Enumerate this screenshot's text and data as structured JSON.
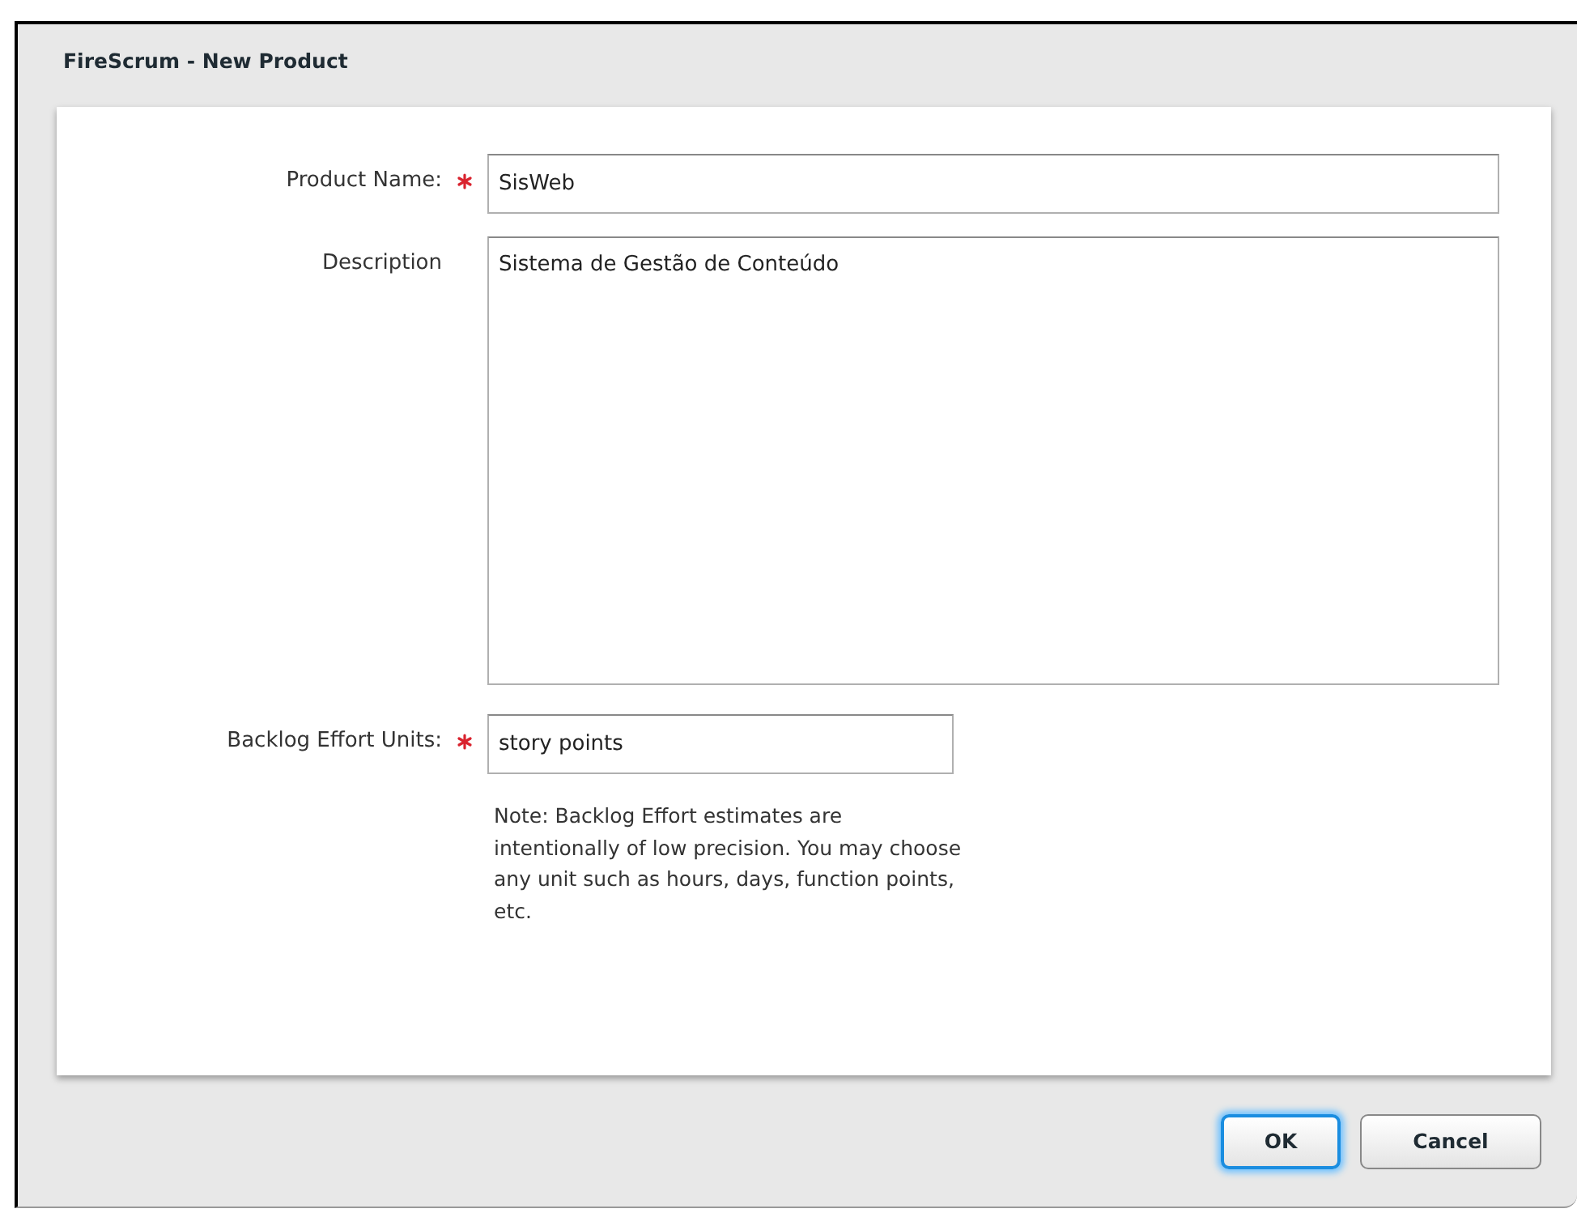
{
  "window": {
    "title": "FireScrum - New Product"
  },
  "fields": [
    {
      "kind": "input",
      "label": "Product Name:",
      "required": true,
      "value": "SisWeb"
    },
    {
      "kind": "textarea",
      "label": "Description",
      "required": false,
      "value": "Sistema de Gestão de Conteúdo"
    },
    {
      "kind": "short-input",
      "label": "Backlog Effort Units:",
      "required": true,
      "value": "story points"
    }
  ],
  "note": "Note: Backlog Effort estimates are intentionally of low precision. You may choose any unit such as hours, days, function points, etc.",
  "buttons": [
    {
      "label": "OK",
      "focused": true
    },
    {
      "label": "Cancel",
      "focused": false
    }
  ]
}
